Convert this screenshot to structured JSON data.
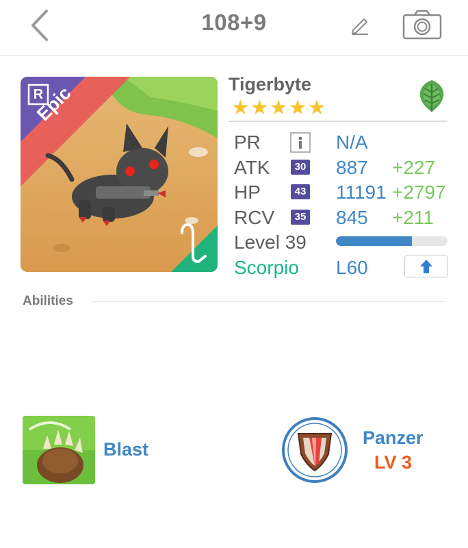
{
  "header": {
    "title": "108+9",
    "icons": [
      "chevron-left-icon",
      "pencil-icon",
      "camera-icon"
    ]
  },
  "monster": {
    "name": "Tigerbyte",
    "stars": 5,
    "stars_text": "★★★★★",
    "rarity": "Epic",
    "rarity_badge": "R",
    "element_icon": "leaf-icon",
    "zodiac_icon": "scorpio-icon"
  },
  "stats": {
    "pr_label": "PR",
    "pr_value": "N/A",
    "atk_label": "ATK",
    "atk_rank": "30",
    "atk_value": "887",
    "atk_bonus": "+227",
    "hp_label": "HP",
    "hp_rank": "43",
    "hp_value": "11191",
    "hp_bonus": "+2797",
    "rcv_label": "RCV",
    "rcv_rank": "35",
    "rcv_value": "845",
    "rcv_bonus": "+211",
    "level_label": "Level 39",
    "level_progress": 0.68,
    "zodiac_label": "Scorpio",
    "zodiac_level": "L60"
  },
  "abilities": {
    "title": "Abilities",
    "active_name": "Blast",
    "passive_name": "Panzer",
    "passive_level": "LV 3"
  },
  "colors": {
    "blue": "#3e86c6",
    "green_bonus": "#79c75c",
    "teal": "#19b68a",
    "orange": "#ee5a1c",
    "purple": "#544c9c",
    "star": "#f8c52d"
  }
}
